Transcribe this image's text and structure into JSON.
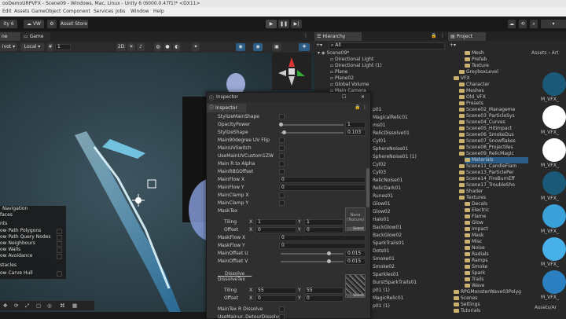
{
  "window": {
    "title": "ooDemoURPVFX - Scene09 - Windows, Mac, Linux - Unity 6 (6000.0.47f1)* <DX11>"
  },
  "menu": [
    "Edit",
    "Assets",
    "GameObject",
    "Component",
    "Services",
    "Jobs",
    "Window",
    "Help"
  ],
  "toolbar": {
    "account": "ity 6",
    "vw_label": "VW",
    "asset_store": "Asset Store"
  },
  "scene_tabs": {
    "scene": "ne",
    "game": "Game"
  },
  "scene_toolbar": {
    "pivot": "ivot",
    "space": "Local",
    "snap_value": "1"
  },
  "hierarchy": {
    "tab": "Hierarchy",
    "search_placeholder": "All",
    "root": "Scene09*",
    "items": [
      "Directional Light",
      "Directional Light (1)",
      "Plane",
      "Plane02",
      "Global Volume",
      "Main Camera"
    ],
    "behind_items": [
      "p01",
      "MagicalRelic01",
      "ms01",
      "RelicDissolve01",
      "Cyl01",
      "SphereNoise01",
      "SphereNoise01 (1)",
      "Cyl02",
      "Cyl03",
      "RelicNoise01",
      "RelicDark01",
      "Runes01",
      "Glow01",
      "Glow02",
      "Halo01",
      "BackGlow01",
      "BackGlow02",
      "SparkTrails01",
      "Dots01",
      "Smoke01",
      "Smoke02",
      "Sparkles01",
      "BurstSparkTrails01",
      "p01 (1)",
      "MagicRelic01",
      "p01 (1)"
    ]
  },
  "project": {
    "tab": "Project",
    "breadcrumb": "Assets › Art",
    "items": [
      {
        "label": "Mesh",
        "indent": 3
      },
      {
        "label": "Prefab",
        "indent": 3
      },
      {
        "label": "Texture",
        "indent": 3
      },
      {
        "label": "GreyboxLevel",
        "indent": 2
      },
      {
        "label": "VFX",
        "indent": 1
      },
      {
        "label": "Character",
        "indent": 2
      },
      {
        "label": "Meshes",
        "indent": 2
      },
      {
        "label": "Old_VFX",
        "indent": 2
      },
      {
        "label": "Presets",
        "indent": 2
      },
      {
        "label": "Scene02_Manageme",
        "indent": 2
      },
      {
        "label": "Scene03_ParticleSys",
        "indent": 2
      },
      {
        "label": "Scene04_Curves",
        "indent": 2
      },
      {
        "label": "Scene05_Hitimpact",
        "indent": 2
      },
      {
        "label": "Scene06_SmokeDus",
        "indent": 2
      },
      {
        "label": "Scene07_Snowflakes",
        "indent": 2
      },
      {
        "label": "Scene08_Projectiles",
        "indent": 2
      },
      {
        "label": "Scene09_RelicMagic",
        "indent": 2
      },
      {
        "label": "Materials",
        "indent": 3
      },
      {
        "label": "Scene11_CandleFlam",
        "indent": 2
      },
      {
        "label": "Scene13_ParticlePer",
        "indent": 2
      },
      {
        "label": "Scene14_FireBurnEff",
        "indent": 2
      },
      {
        "label": "Scene17_TroubleSho",
        "indent": 2
      },
      {
        "label": "Shader",
        "indent": 2
      },
      {
        "label": "Textures",
        "indent": 2
      },
      {
        "label": "Decals",
        "indent": 3
      },
      {
        "label": "Electric",
        "indent": 3
      },
      {
        "label": "Flame",
        "indent": 3
      },
      {
        "label": "Glow",
        "indent": 3
      },
      {
        "label": "Impact",
        "indent": 3
      },
      {
        "label": "Mask",
        "indent": 3
      },
      {
        "label": "Misc",
        "indent": 3
      },
      {
        "label": "Noise",
        "indent": 3
      },
      {
        "label": "Radials",
        "indent": 3
      },
      {
        "label": "Ramps",
        "indent": 3
      },
      {
        "label": "Smoke",
        "indent": 3
      },
      {
        "label": "Spark",
        "indent": 3
      },
      {
        "label": "Trails",
        "indent": 3
      },
      {
        "label": "Wave",
        "indent": 3
      },
      {
        "label": "RPGMonsterWave03Polyg",
        "indent": 1
      },
      {
        "label": "Scenes",
        "indent": 1
      },
      {
        "label": "Settings",
        "indent": 1
      },
      {
        "label": "Tutorials",
        "indent": 1
      }
    ],
    "thumb_labels": [
      "M_VFX_",
      "M_VFX_",
      "M_VFX_",
      "M_VFX_",
      "M_VFX_",
      "M_VFX_",
      "M_VFX_"
    ],
    "footer": "Assets/Ar"
  },
  "inspector": {
    "title": "Inspector",
    "tab": "Inspector",
    "properties": [
      {
        "label": "StylizeMainShape",
        "kind": "check"
      },
      {
        "label": "OpacityPower",
        "kind": "slider",
        "value": "1",
        "fill": 0.0
      },
      {
        "label": "StylizeShape",
        "kind": "slider",
        "value": "0.103",
        "fill": 0.05
      },
      {
        "label": "Main90degree UV Flip",
        "kind": "check"
      },
      {
        "label": "MainUVSwitch",
        "kind": "check"
      },
      {
        "label": "UseMainUVCustom1ZW",
        "kind": "check"
      },
      {
        "label": "Main R to Alpha",
        "kind": "check"
      },
      {
        "label": "MainRBGOffset",
        "kind": "check"
      },
      {
        "label": "MainFlow X",
        "kind": "float",
        "value": "0"
      },
      {
        "label": "MainFlow Y",
        "kind": "float",
        "value": "0"
      },
      {
        "label": "MainClamp X",
        "kind": "check"
      },
      {
        "label": "MainClamp Y",
        "kind": "check"
      },
      {
        "label": "MaskTex",
        "kind": "texture",
        "tex_label": "None (Texture)",
        "select": "Select"
      }
    ],
    "mask_tiling": {
      "label": "Tiling",
      "x": "1",
      "y": "1"
    },
    "mask_offset": {
      "label": "Offset",
      "x": "0",
      "y": "0"
    },
    "properties2": [
      {
        "label": "MaskFlow X",
        "kind": "float",
        "value": "0"
      },
      {
        "label": "MaskFlow Y",
        "kind": "float",
        "value": "0"
      },
      {
        "label": "MainOffset U",
        "kind": "slider",
        "value": "0.015",
        "fill": 0.76
      },
      {
        "label": "MainOffset V",
        "kind": "slider",
        "value": "0.015",
        "fill": 0.76
      }
    ],
    "dissolve_header": "___Dissolve___",
    "dissolve_tex": "DissolveTex",
    "dissolve_tiling": {
      "label": "Tiling",
      "x": "55",
      "y": "55"
    },
    "dissolve_offset": {
      "label": "Offset",
      "x": "0",
      "y": "0"
    },
    "dissolve_select": "Select",
    "tail": [
      "MainTex R Dissolve",
      "UseMainur..DetourDissolve"
    ]
  },
  "navigation": {
    "title": "Navigation",
    "subtitle": "faces",
    "section": "nts",
    "options": [
      "ow Path Polygons",
      "ow Path Query Nodes",
      "ow Neighbours",
      "ow Walls",
      "ow Avoidance"
    ],
    "section2": "stacles",
    "options2": [
      "ow Carve Hull"
    ]
  },
  "colors": {
    "accent": "#2c5d87",
    "selected_row": "#2c5d87",
    "scene_bg": "#2a3a40",
    "glow": "#5fd0ff"
  }
}
